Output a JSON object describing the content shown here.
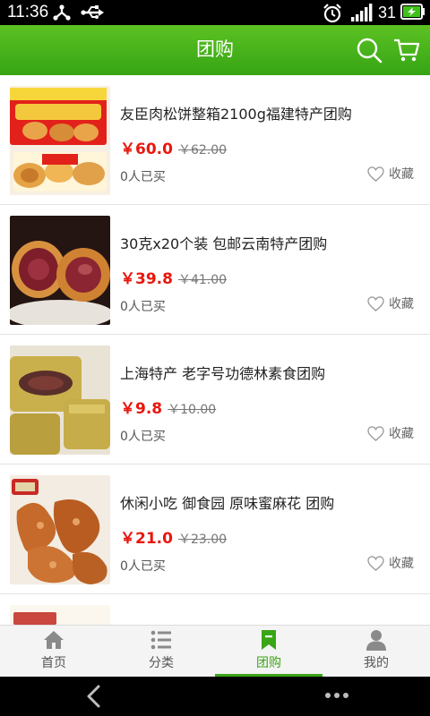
{
  "status_bar": {
    "time": "11:36",
    "battery_level": "31",
    "icons": [
      "usb-share-icon",
      "usb-icon",
      "alarm-icon",
      "signal-icon",
      "battery-charging-icon"
    ]
  },
  "header": {
    "title": "团购",
    "icons": [
      "search-icon",
      "cart-icon"
    ]
  },
  "products": [
    {
      "name": "友臣肉松饼整箱2100g福建特产团购",
      "price": "￥60.0",
      "original_price": "￥62.00",
      "sold": "0人已买",
      "favorite_label": "收藏"
    },
    {
      "name": "30克x20个装 包邮云南特产团购",
      "price": "￥39.8",
      "original_price": "￥41.00",
      "sold": "0人已买",
      "favorite_label": "收藏"
    },
    {
      "name": "上海特产 老字号功德林素食团购",
      "price": "￥9.8",
      "original_price": "￥10.00",
      "sold": "0人已买",
      "favorite_label": "收藏"
    },
    {
      "name": "休闲小吃 御食园 原味蜜麻花 团购",
      "price": "￥21.0",
      "original_price": "￥23.00",
      "sold": "0人已买",
      "favorite_label": "收藏"
    }
  ],
  "tabbar": {
    "tabs": [
      {
        "label": "首页",
        "icon": "home-icon"
      },
      {
        "label": "分类",
        "icon": "list-icon"
      },
      {
        "label": "团购",
        "icon": "bookmark-icon",
        "active": true
      },
      {
        "label": "我的",
        "icon": "user-icon"
      }
    ]
  },
  "nav_bar": {
    "icons": [
      "back-icon",
      "more-icon"
    ]
  },
  "colors": {
    "accent": "#3aa516",
    "price": "#e8170e",
    "header_top": "#5cc223",
    "header_bottom": "#36a414"
  }
}
